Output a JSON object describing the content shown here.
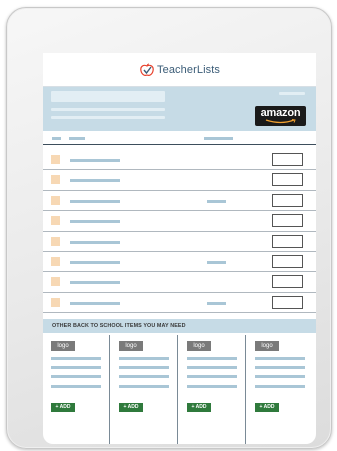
{
  "header": {
    "brand_name": "TeacherLists",
    "brand_color": "#3b5c77",
    "accent_color": "#e8412c"
  },
  "retailer_button": {
    "label": "amazon",
    "icon": "amazon-smile-icon"
  },
  "list": {
    "rows": [
      {
        "has_price": false
      },
      {
        "has_price": false
      },
      {
        "has_price": true
      },
      {
        "has_price": false
      },
      {
        "has_price": false
      },
      {
        "has_price": true
      },
      {
        "has_price": false
      },
      {
        "has_price": true
      }
    ]
  },
  "other_items": {
    "heading": "OTHER BACK TO SCHOOL ITEMS YOU MAY NEED",
    "products": [
      {
        "logo_label": "logo",
        "add_label": "+ ADD"
      },
      {
        "logo_label": "logo",
        "add_label": "+ ADD"
      },
      {
        "logo_label": "logo",
        "add_label": "+ ADD"
      },
      {
        "logo_label": "logo",
        "add_label": "+ ADD"
      }
    ]
  }
}
